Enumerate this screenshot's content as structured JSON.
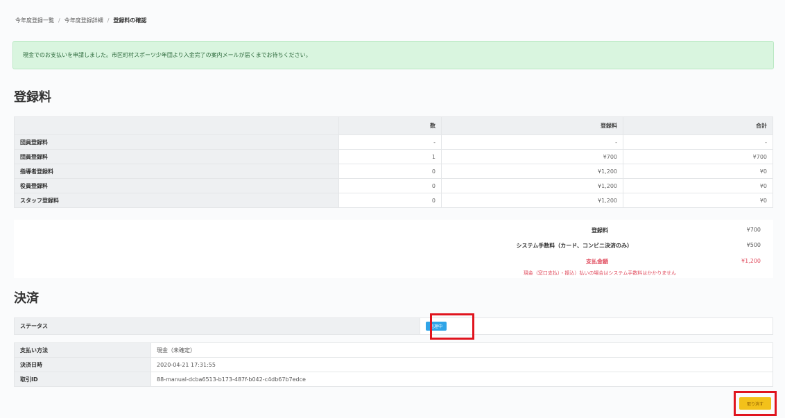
{
  "breadcrumb": [
    "今年度登録一覧",
    "今年度登録詳細",
    "登録料の確認"
  ],
  "alert": "現金でのお支払いを申請しました。市区町村スポーツ少年団より入金完了の案内メールが届くまでお待ちください。",
  "fee_section": {
    "title": "登録料",
    "headers": [
      "",
      "数",
      "登録料",
      "合計"
    ],
    "rows": [
      {
        "label": "団員登録料",
        "count": "-",
        "fee": "-",
        "total": "-"
      },
      {
        "label": "団員登録料",
        "count": "1",
        "fee": "¥700",
        "total": "¥700"
      },
      {
        "label": "指導者登録料",
        "count": "0",
        "fee": "¥1,200",
        "total": "¥0"
      },
      {
        "label": "役員登録料",
        "count": "0",
        "fee": "¥1,200",
        "total": "¥0"
      },
      {
        "label": "スタッフ登録料",
        "count": "0",
        "fee": "¥1,200",
        "total": "¥0"
      }
    ],
    "summary": {
      "subtotal_label": "登録料",
      "subtotal_value": "¥700",
      "system_fee_label": "システム手数料（カード、コンビニ決済のみ）",
      "system_fee_value": "¥500",
      "total_label": "支払金額",
      "total_value": "¥1,200",
      "note": "現金（窓口支払）・振込）払いの場合はシステム手数料はかかりません"
    }
  },
  "settlement": {
    "title": "決済",
    "status_label": "ステータス",
    "status_badge": "処理中",
    "details": [
      {
        "label": "支払い方法",
        "value": "現金（未確定）"
      },
      {
        "label": "決済日時",
        "value": "2020-04-21 17:31:55"
      },
      {
        "label": "取引ID",
        "value": "88-manual-dcba6513-b173-487f-b042-c4db67b7edce"
      }
    ],
    "action_button": "取り消す"
  },
  "colors": {
    "alert_bg": "#d9f5df",
    "badge": "#2fa4e7",
    "button": "#f3c11a",
    "highlight": "#e0141e",
    "total_red": "#e04a5c"
  }
}
